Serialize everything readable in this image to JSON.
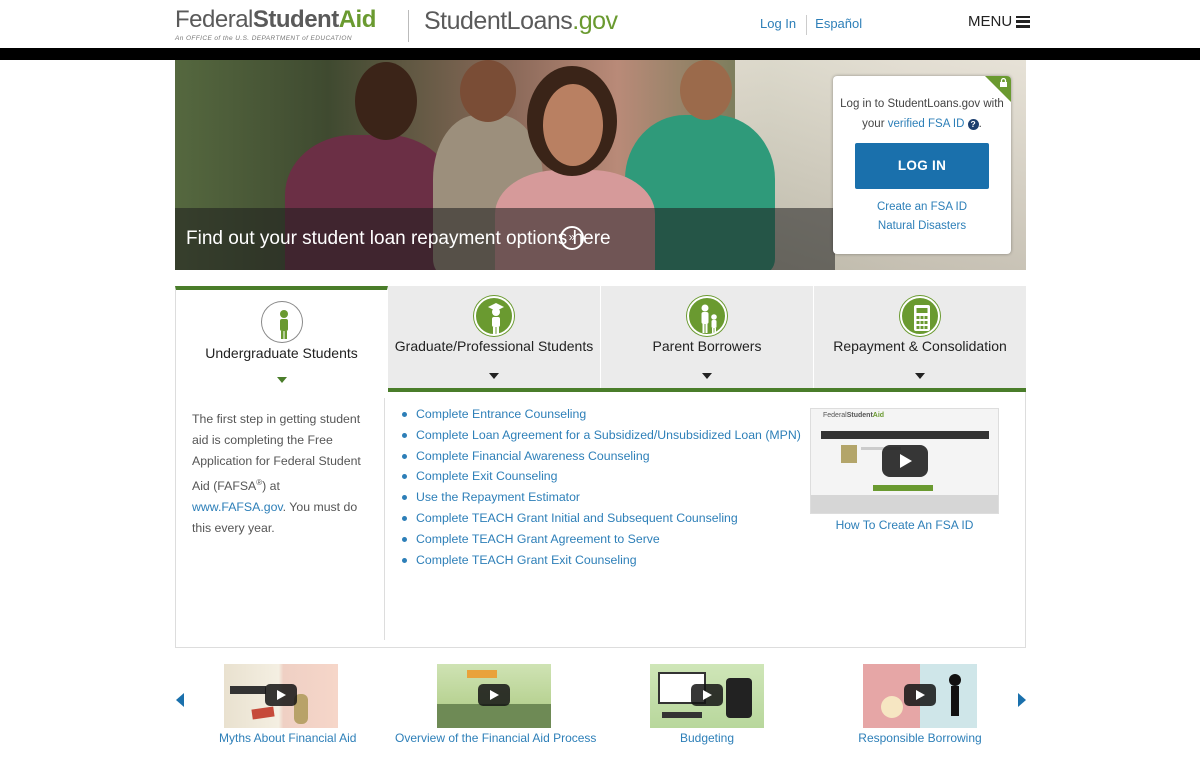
{
  "header": {
    "fsa_word1": "Federal",
    "fsa_word2": "Student",
    "fsa_word3": "Aid",
    "fsa_tagline": "An OFFICE of the U.S. DEPARTMENT of EDUCATION",
    "sl_main": "StudentLoans",
    "sl_tld": ".gov",
    "login_link": "Log In",
    "espanol_link": "Español",
    "menu_label": "MENU"
  },
  "hero": {
    "caption": "Find out your student loan repayment options here",
    "caption_icon": "»"
  },
  "login_box": {
    "text_line1": "Log in to StudentLoans.gov with",
    "text_line2_pre": "your",
    "text_line2_link": "verified FSA ID",
    "help_icon": "?",
    "text_line2_post": ".",
    "button": "LOG IN",
    "create_link": "Create an FSA ID",
    "disasters_link": "Natural Disasters"
  },
  "tabs": [
    {
      "label": "Undergraduate Students",
      "icon": "student-icon"
    },
    {
      "label": "Graduate/Professional Students",
      "icon": "graduate-icon"
    },
    {
      "label": "Parent Borrowers",
      "icon": "parent-child-icon"
    },
    {
      "label": "Repayment & Consolidation",
      "icon": "calculator-icon"
    }
  ],
  "content": {
    "desc_pre": "The first step in getting student aid is completing the Free Application for Federal Student Aid (FAFSA",
    "desc_reg": "®",
    "desc_mid": ") at",
    "desc_link": "www.FAFSA.gov",
    "desc_post": ". You must do this every year.",
    "links": [
      "Complete Entrance Counseling",
      "Complete Loan Agreement for a Subsidized/Unsubsidized Loan (MPN)",
      "Complete Financial Awareness Counseling",
      "Complete Exit Counseling",
      "Use the Repayment Estimator",
      "Complete TEACH Grant Initial and Subsequent Counseling",
      "Complete TEACH Grant Agreement to Serve",
      "Complete TEACH Grant Exit Counseling"
    ],
    "video_caption": "How To Create An FSA ID"
  },
  "carousel": [
    {
      "caption": "Myths About Financial Aid"
    },
    {
      "caption": "Overview of the Financial Aid Process"
    },
    {
      "caption": "Budgeting"
    },
    {
      "caption": "Responsible Borrowing"
    }
  ],
  "colors": {
    "brand_green": "#6a9a30",
    "tab_green": "#4a7d2a",
    "link_blue": "#2d7fb8",
    "button_blue": "#1a70ac"
  }
}
